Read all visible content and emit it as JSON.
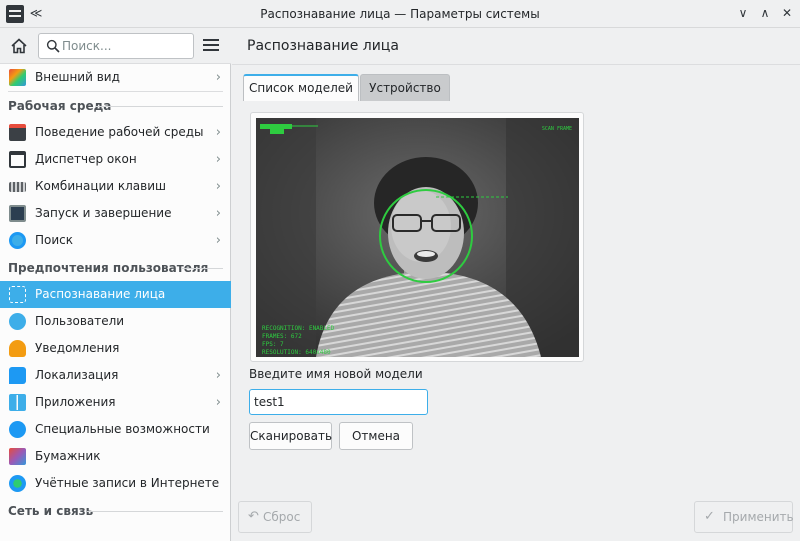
{
  "window": {
    "title": "Распознавание лица — Параметры системы",
    "keep_above_glyph": "≪",
    "minimize_glyph": "∨",
    "maximize_glyph": "∧",
    "close_glyph": "✕"
  },
  "sidebar": {
    "search_placeholder": "Поиск...",
    "items_top": [
      {
        "label": "Внешний вид",
        "icon": "appearance-icon",
        "chevron": "›"
      }
    ],
    "category_workspace": "Рабочая среда",
    "items_workspace": [
      {
        "label": "Поведение рабочей среды",
        "icon": "desktop-behavior-icon",
        "chevron": "›"
      },
      {
        "label": "Диспетчер окон",
        "icon": "window-manager-icon",
        "chevron": "›"
      },
      {
        "label": "Комбинации клавиш",
        "icon": "keyboard-icon",
        "chevron": "›"
      },
      {
        "label": "Запуск и завершение",
        "icon": "startup-shutdown-icon",
        "chevron": "›"
      },
      {
        "label": "Поиск",
        "icon": "search-settings-icon",
        "chevron": "›"
      }
    ],
    "category_personalization": "Предпочтения пользователя",
    "items_personalization": [
      {
        "label": "Распознавание лица",
        "icon": "face-recognition-icon",
        "chevron": ""
      },
      {
        "label": "Пользователи",
        "icon": "users-icon",
        "chevron": ""
      },
      {
        "label": "Уведомления",
        "icon": "bell-icon",
        "chevron": ""
      },
      {
        "label": "Локализация",
        "icon": "localization-icon",
        "chevron": "›"
      },
      {
        "label": "Приложения",
        "icon": "applications-icon",
        "chevron": "›"
      },
      {
        "label": "Специальные возможности",
        "icon": "accessibility-icon",
        "chevron": ""
      },
      {
        "label": "Бумажник",
        "icon": "wallet-icon",
        "chevron": ""
      },
      {
        "label": "Учётные записи в Интернете",
        "icon": "online-accounts-icon",
        "chevron": ""
      }
    ],
    "category_network": "Сеть и связь"
  },
  "main": {
    "title": "Распознавание лица",
    "tabs": [
      {
        "label": "Список моделей",
        "active": true
      },
      {
        "label": "Устройство",
        "active": false
      }
    ],
    "camera_overlay": {
      "top_right": "SCAN FRAME",
      "lines": [
        "RECOGNITION: ENABLED",
        "FRAMES: 672",
        "FPS: 7",
        "RESOLUTION: 640x480"
      ]
    },
    "new_model_prompt": "Введите имя новой модели",
    "model_name_value": "test1",
    "scan_button": "Сканировать",
    "cancel_button": "Отмена",
    "reset_button": "Сброс",
    "apply_button": "Применить"
  },
  "colors": {
    "accent": "#3daee9",
    "overlay_green": "#2ecc40"
  }
}
